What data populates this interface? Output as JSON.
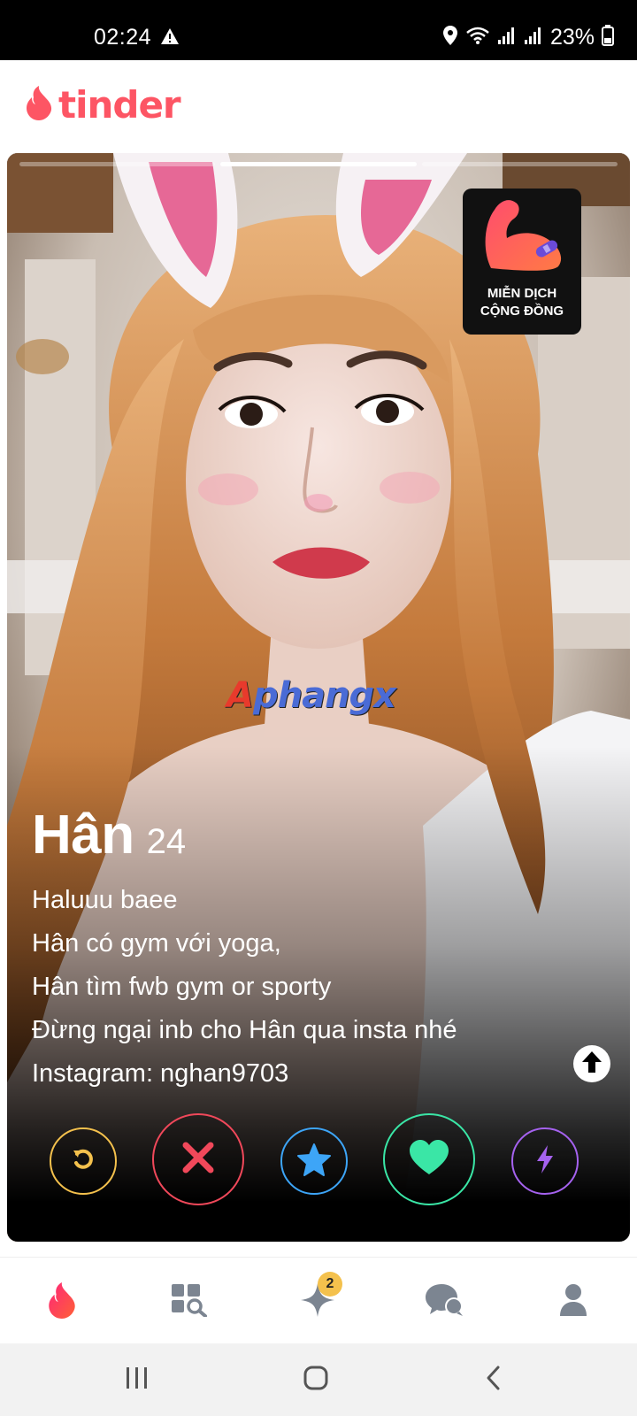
{
  "status_bar": {
    "time": "02:24",
    "battery": "23%",
    "icons": [
      "warning-icon",
      "location-icon",
      "wifi-icon",
      "signal-icon",
      "signal-icon",
      "battery-icon"
    ]
  },
  "header": {
    "logo_text": "tinder",
    "brand_color": "#fd5564"
  },
  "card": {
    "photo_count": 3,
    "active_photo": 1,
    "badge": {
      "line1": "MIỄN DỊCH",
      "line2": "CỘNG ĐỒNG",
      "icon": "flexed-arm-icon"
    },
    "watermark": {
      "first": "A",
      "rest": "phangx"
    },
    "profile": {
      "name": "Hân",
      "age": "24",
      "bio": [
        "Haluuu baee",
        "Hân có gym với yoga,",
        "Hân tìm fwb gym or sporty",
        "Đừng ngại inb cho Hân qua insta nhé",
        "Instagram: nghan9703"
      ]
    },
    "actions": [
      {
        "name": "rewind",
        "icon": "rewind-icon",
        "color": "#f4c14d"
      },
      {
        "name": "nope",
        "icon": "close-icon",
        "color": "#f0485a"
      },
      {
        "name": "super-like",
        "icon": "star-icon",
        "color": "#3da5f7"
      },
      {
        "name": "like",
        "icon": "heart-icon",
        "color": "#3ae6a6"
      },
      {
        "name": "boost",
        "icon": "lightning-icon",
        "color": "#a562ef"
      }
    ]
  },
  "bottom_nav": {
    "items": [
      {
        "name": "discover",
        "icon": "flame-icon",
        "active": true
      },
      {
        "name": "explore",
        "icon": "explore-grid-icon",
        "active": false
      },
      {
        "name": "likes",
        "icon": "sparkle-icon",
        "active": false,
        "badge": "2"
      },
      {
        "name": "messages",
        "icon": "chat-icon",
        "active": false
      },
      {
        "name": "profile",
        "icon": "person-icon",
        "active": false
      }
    ]
  },
  "system_nav": {
    "icons": [
      "recent-apps-icon",
      "home-icon",
      "back-icon"
    ]
  }
}
